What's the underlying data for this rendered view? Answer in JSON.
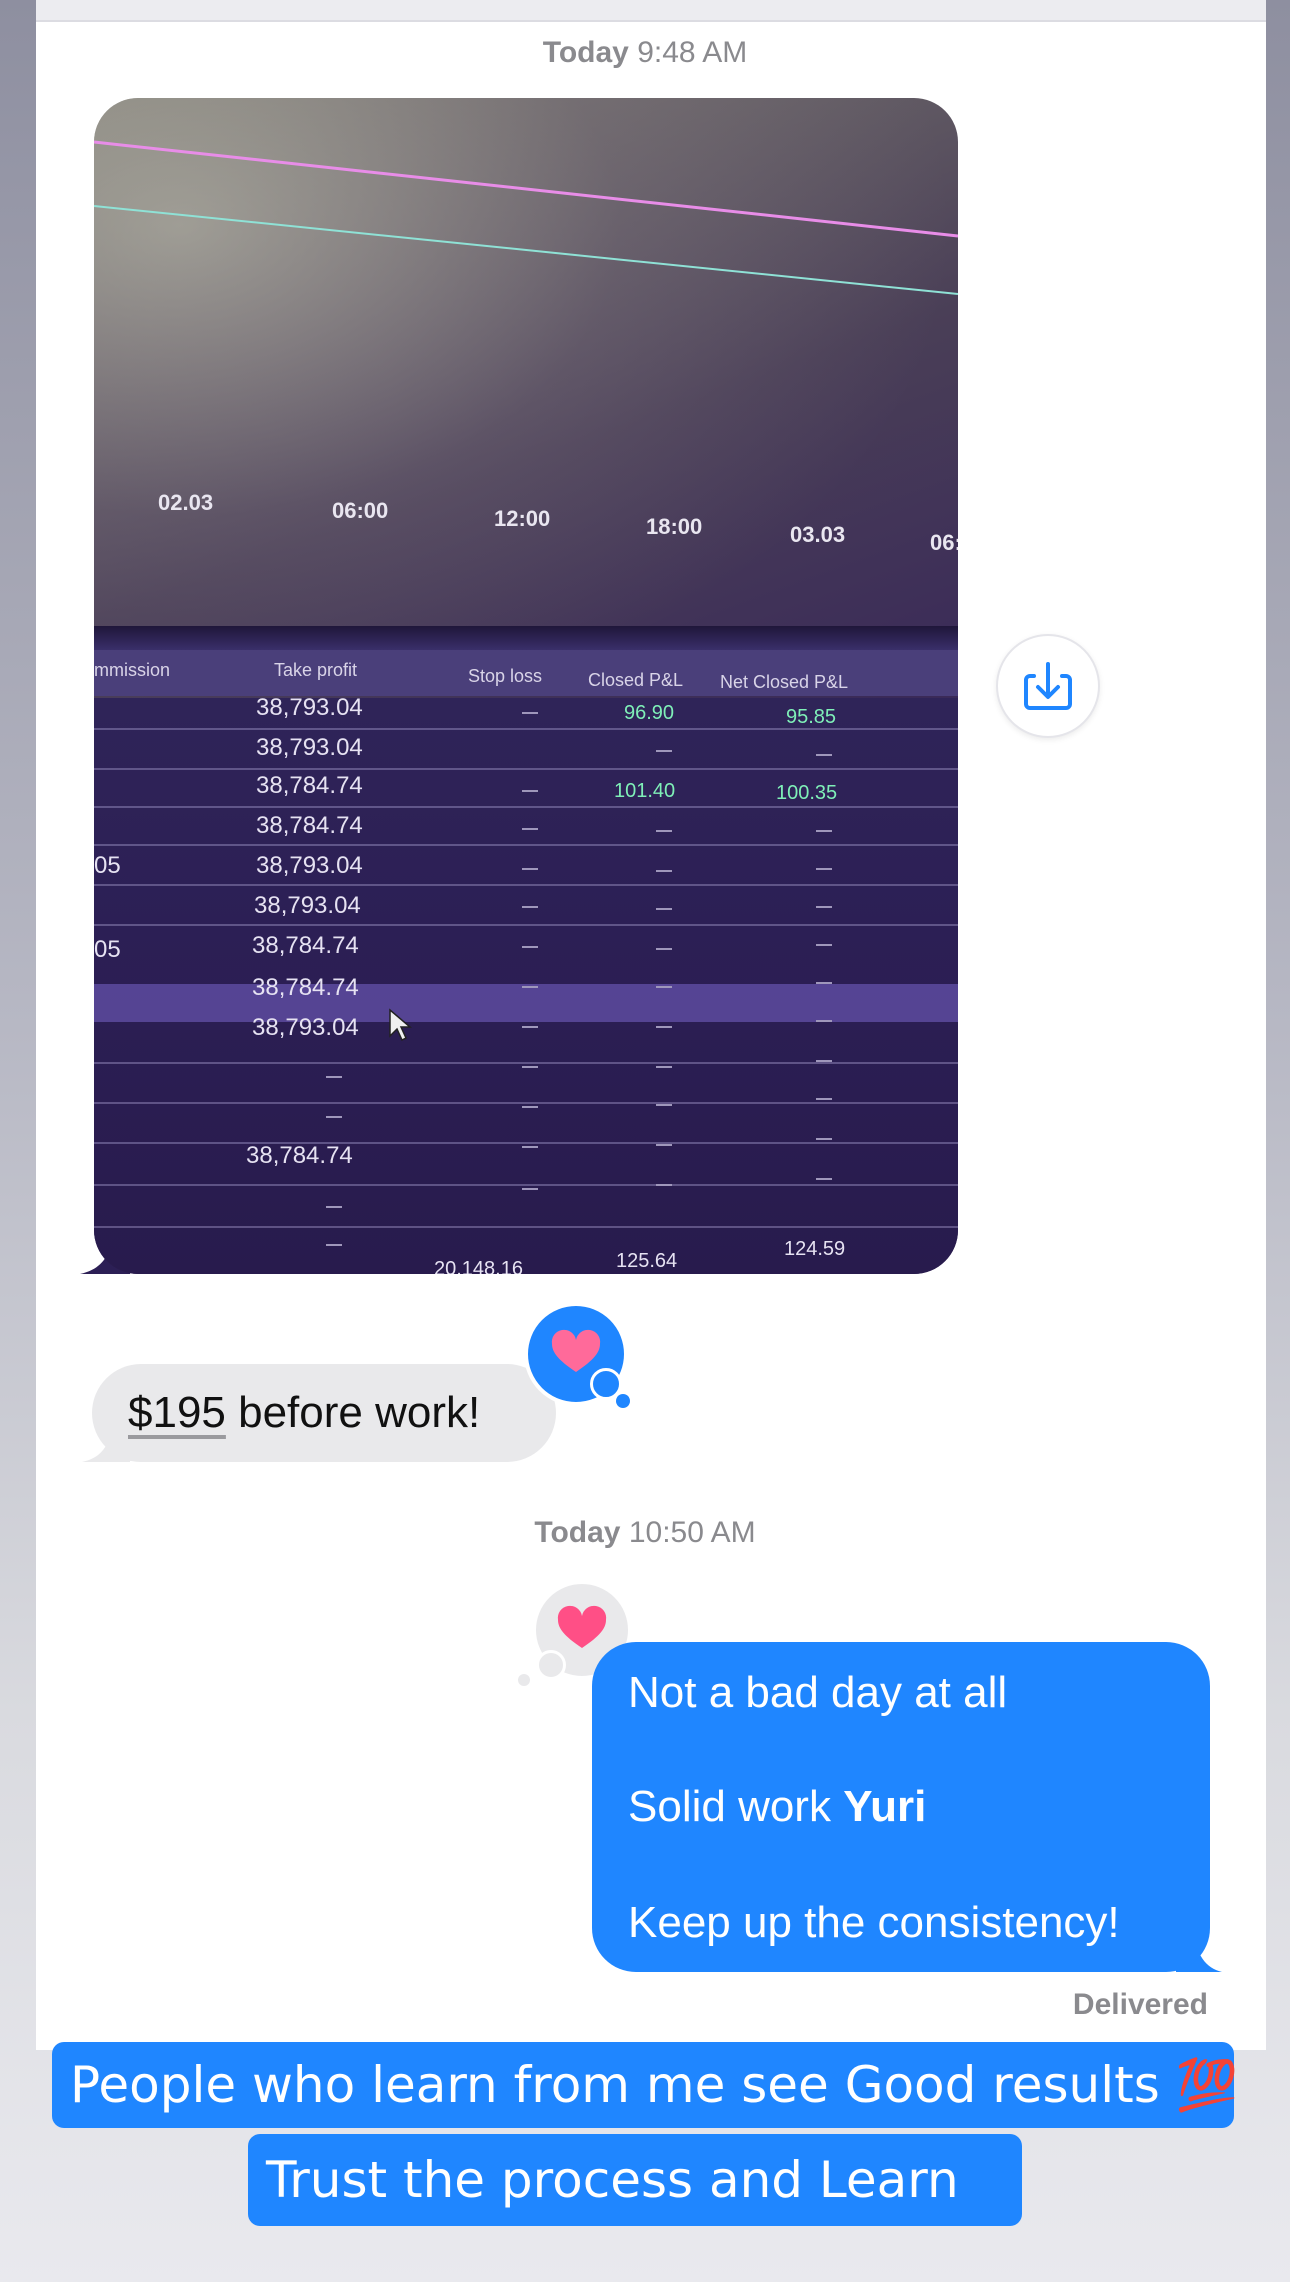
{
  "thread": {
    "timestamp1": {
      "day": "Today",
      "time": "9:48 AM"
    },
    "timestamp2": {
      "day": "Today",
      "time": "10:50 AM"
    },
    "photo": {
      "time_ticks": [
        "02.03",
        "06:00",
        "12:00",
        "18:00",
        "03.03",
        "06:"
      ],
      "columns": [
        "mmission",
        "Take profit",
        "Stop loss",
        "Closed P&L",
        "Net Closed P&L"
      ],
      "take_profit_values": [
        "38,793.04",
        "38,793.04",
        "38,784.74",
        "38,784.74",
        "38,793.04",
        "38,793.04",
        "38,784.74",
        "38,784.74",
        "38,793.04",
        "",
        "",
        "38,784.74"
      ],
      "left_col": [
        "05",
        "05"
      ],
      "closed_pl": [
        "96.90",
        "101.40"
      ],
      "net_closed_pl": [
        "95.85",
        "100.35"
      ],
      "totals": {
        "partial": "20,148.16",
        "closed": "125.64",
        "net": "124.59"
      }
    },
    "incoming_message": {
      "amount": "$195",
      "text": " before work!",
      "reaction": "heart"
    },
    "outgoing_message": {
      "line1": "Not a bad day at all",
      "line2_prefix": "Solid work ",
      "line2_name": "Yuri",
      "line3": "Keep up the consistency!",
      "reaction": "heart"
    },
    "status": "Delivered"
  },
  "captions": {
    "line1": "People who learn from me see Good results 💯",
    "line2": "Trust the process and Learn"
  },
  "colors": {
    "blue": "#1f86ff",
    "gray_bubble": "#e9e9eb",
    "heart": "#ff3b6b"
  }
}
